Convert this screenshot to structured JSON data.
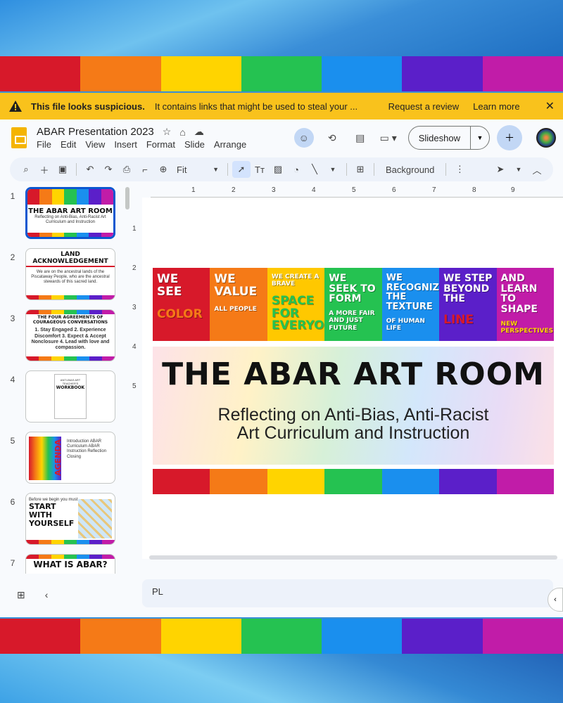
{
  "palette": [
    "#d7192a",
    "#f57a17",
    "#ffd400",
    "#25c251",
    "#1a8fee",
    "#5b1fc9",
    "#c11ca8"
  ],
  "warning": {
    "title": "This file looks suspicious.",
    "message": "It contains links that might be used to steal your ...",
    "review_label": "Request a review",
    "learn_label": "Learn more"
  },
  "doc": {
    "title": "ABAR Presentation 2023",
    "menus": [
      "File",
      "Edit",
      "View",
      "Insert",
      "Format",
      "Slide",
      "Arrange"
    ]
  },
  "header": {
    "slideshow_label": "Slideshow"
  },
  "toolbar": {
    "zoom_label": "Fit",
    "background_label": "Background"
  },
  "ruler": {
    "top": [
      "1",
      "2",
      "3",
      "4",
      "5",
      "6",
      "7",
      "8",
      "9"
    ],
    "left": [
      "1",
      "2",
      "3",
      "4",
      "5"
    ]
  },
  "thumbnails": [
    {
      "num": "1",
      "title": "THE ABAR ART ROOM",
      "sub": "Reflecting on Anti-Bias, Anti-Racist Art Curriculum and Instruction"
    },
    {
      "num": "2",
      "title": "LAND ACKNOWLEDGEMENT",
      "sub": "We are on the ancestral lands of the Piscataway People, who are the ancestral stewards of this sacred land."
    },
    {
      "num": "3",
      "title": "THE FOUR AGREEMENTS OF COURAGEOUS CONVERSATIONS",
      "sub": "1. Stay Engaged 2. Experience Discomfort 3. Expect & Accept Nonclosure 4. Lead with love and compassion."
    },
    {
      "num": "4",
      "title": "WORKBOOK",
      "sub": "ANTI-BIAS ART TEACHER'S"
    },
    {
      "num": "5",
      "title": "AGENDA",
      "sub": "Introduction ABAR Curriculum ABAR Instruction Reflection Closing"
    },
    {
      "num": "6",
      "title": "START WITH YOURSELF",
      "sub": "Before we begin you must"
    },
    {
      "num": "7",
      "title": "WHAT IS ABAR?",
      "sub": ""
    }
  ],
  "slide": {
    "columns": [
      {
        "top": "WE SEE",
        "bottom": "COLOR",
        "color": "#d7192a"
      },
      {
        "top": "WE VALUE",
        "bottom": "ALL PEOPLE",
        "color": "#f57a17"
      },
      {
        "top": "WE CREATE A BRAVE",
        "bottom": "SPACE FOR EVERYONE",
        "color": "#ffc800"
      },
      {
        "top": "WE SEEK TO FORM",
        "bottom": "A MORE FAIR AND JUST FUTURE",
        "color": "#25c251"
      },
      {
        "top": "WE RECOGNIZE THE TEXTURE",
        "bottom": "OF HUMAN LIFE",
        "color": "#1a8fee"
      },
      {
        "top": "WE STEP BEYOND THE",
        "bottom": "LINE",
        "color": "#5b1fc9"
      },
      {
        "top": "AND LEARN TO SHAPE",
        "bottom": "NEW PERSPECTIVES",
        "color": "#c11ca8"
      }
    ],
    "title": "THE ABAR ART ROOM",
    "subtitle_line1": "Reflecting on Anti-Bias, Anti-Racist",
    "subtitle_line2": "Art Curriculum and Instruction"
  },
  "notes": {
    "text": "PL"
  }
}
